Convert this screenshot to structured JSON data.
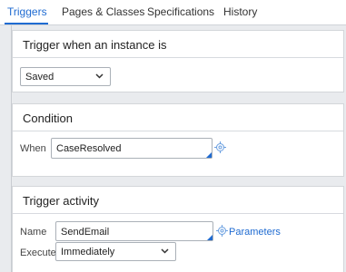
{
  "tabs": [
    {
      "label": "Triggers",
      "active": true
    },
    {
      "label": "Pages & Classes",
      "active": false
    },
    {
      "label": "Specifications",
      "active": false
    },
    {
      "label": "History",
      "active": false
    }
  ],
  "trigger_section": {
    "title": "Trigger when an instance is",
    "select_value": "Saved"
  },
  "condition_section": {
    "title": "Condition",
    "when_label": "When",
    "when_value": "CaseResolved"
  },
  "activity_section": {
    "title": "Trigger activity",
    "name_label": "Name",
    "name_value": "SendEmail",
    "parameters_link": "Parameters",
    "execute_label": "Execute",
    "execute_value": "Immediately"
  },
  "colors": {
    "accent": "#1f6bd1",
    "background": "#e9ebee",
    "panel": "#ffffff"
  },
  "icons": [
    "target-icon",
    "chevron-down-icon"
  ]
}
